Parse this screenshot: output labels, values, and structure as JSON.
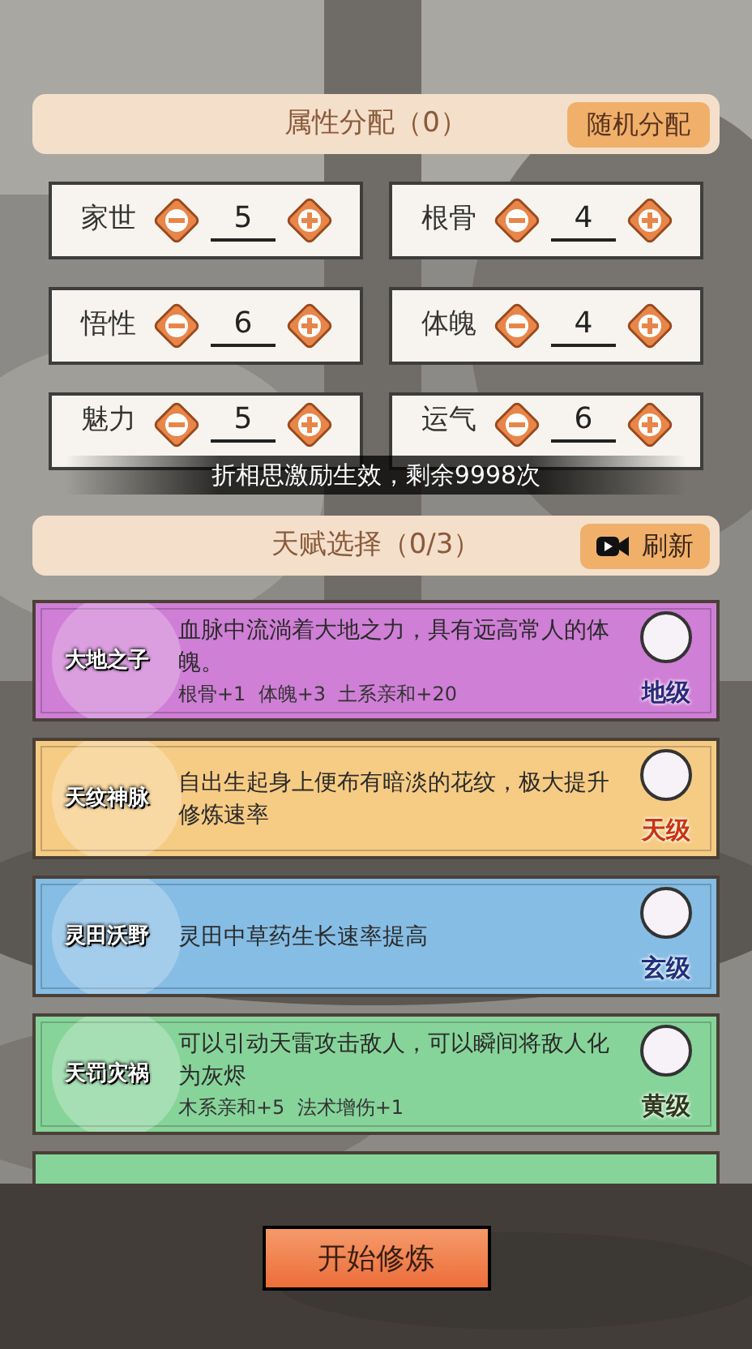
{
  "attributes_header": {
    "title": "属性分配（0）",
    "random_button": "随机分配"
  },
  "attributes": [
    {
      "label": "家世",
      "value": "5"
    },
    {
      "label": "根骨",
      "value": "4"
    },
    {
      "label": "悟性",
      "value": "6"
    },
    {
      "label": "体魄",
      "value": "4"
    },
    {
      "label": "魅力",
      "value": "5"
    },
    {
      "label": "运气",
      "value": "6"
    }
  ],
  "toast": "折相思激励生效，剩余9998次",
  "talents_header": {
    "title": "天赋选择（0/3）",
    "refresh_button": "刷新"
  },
  "talents": [
    {
      "name": "大地之子",
      "description": "血脉中流淌着大地之力，具有远高常人的体魄。",
      "bonus": "根骨+1  体魄+3  土系亲和+20",
      "grade": "地级",
      "kind": "di",
      "color": "#cf7fd6",
      "selected": false
    },
    {
      "name": "天纹神脉",
      "description": "自出生起身上便布有暗淡的花纹，极大提升修炼速率",
      "grade": "天级",
      "kind": "tian",
      "color": "#f6cb84",
      "selected": false
    },
    {
      "name": "灵田沃野",
      "description": "灵田中草药生长速率提高",
      "grade": "玄级",
      "kind": "xuan",
      "color": "#86bde4",
      "selected": false
    },
    {
      "name": "天罚灾祸",
      "description": "可以引动天雷攻击敌人，可以瞬间将敌人化为灰烬",
      "bonus": "木系亲和+5  法术增伤+1",
      "grade": "黄级",
      "kind": "huang",
      "color": "#87d49a",
      "selected": false
    }
  ],
  "partial_talent": {
    "color": "#87d49a"
  },
  "start_button": "开始修炼"
}
